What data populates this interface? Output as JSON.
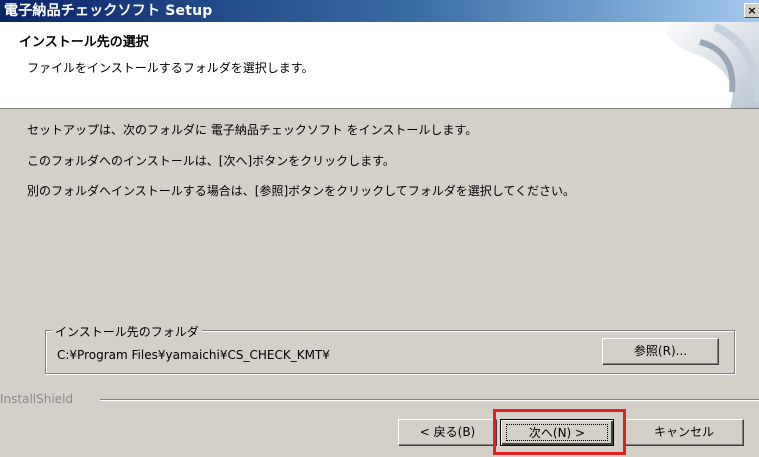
{
  "window": {
    "title": "電子納品チェックソフト Setup",
    "close_symbol": "×"
  },
  "header": {
    "title": "インストール先の選択",
    "subtitle": "ファイルをインストールするフォルダを選択します。"
  },
  "body": {
    "line1": "セットアップは、次のフォルダに 電子納品チェックソフト をインストールします。",
    "line2": "このフォルダへのインストールは、[次へ]ボタンをクリックします。",
    "line3": "別のフォルダへインストールする場合は、[参照]ボタンをクリックしてフォルダを選択してください。"
  },
  "destination": {
    "group_label": "インストール先のフォルダ",
    "path": "C:¥Program Files¥yamaichi¥CS_CHECK_KMT¥",
    "browse_label": "参照(R)..."
  },
  "footer": {
    "brand": "InstallShield",
    "back_label": "< 戻る(B)",
    "next_label": "次へ(N) >",
    "cancel_label": "キャンセル"
  },
  "colors": {
    "title_bar": "#0a246a",
    "dialog_bg": "#d4d0c8",
    "highlight": "#e02020"
  }
}
